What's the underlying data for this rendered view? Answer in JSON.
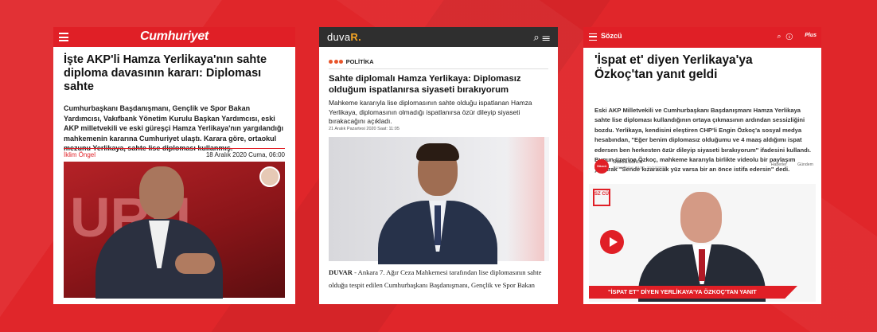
{
  "cumhuriyet": {
    "logo": "Cumhuriyet",
    "title": "İşte AKP'li Hamza Yerlikaya'nın sahte diploma davasının kararı: Diploması sahte",
    "summary": "Cumhurbaşkanı Başdanışmanı, Gençlik ve Spor Bakan Yardımcısı, Vakıfbank Yönetim Kurulu Başkan Yardımcısı, eski AKP milletvekili ve eski güreşçi Hamza Yerlikaya'nın yargılandığı mahkemenin kararına Cumhuriyet ulaştı. Karara göre, ortaokul mezunu Yerlikaya, sahte lise diploması kullanmış.",
    "author": "İklim Öngel",
    "date": "18 Aralık 2020 Cuma, 06:00"
  },
  "duvar": {
    "logo_prefix": "duva",
    "logo_suffix": "R.",
    "kicker": "POLİTİKA",
    "title": "Sahte diplomalı Hamza Yerlikaya: Diplomasız olduğum ispatlanırsa siyaseti bırakıyorum",
    "summary": "Mahkeme kararıyla lise diplomasının sahte olduğu ispatlanan Hamza Yerlikaya, diplomasının olmadığı ispatlanırsa özür dileyip siyaseti bırakacağını açıkladı.",
    "date": "21 Aralık Pazartesi 2020   Saat: 11:05",
    "body_lead": "DUVAR",
    "body": " - Ankara 7. Ağır Ceza Mahkemesi tarafından lise diplomasının sahte olduğu tespit edilen Cumhurbaşkanı Başdanışmanı, Gençlik ve Spor Bakan"
  },
  "sozcu": {
    "logo": "Sözcü",
    "plus": "Plus",
    "title": "'İspat et' diyen Yerlikaya'ya Özkoç'tan yanıt geldi",
    "summary": "Eski AKP Milletvekili ve Cumhurbaşkanı Başdanışmanı Hamza Yerlikaya sahte lise diploması kullandığının ortaya çıkmasının ardından sessizliğini bozdu. Yerlikaya, kendisini eleştiren CHP'li Engin Özkoç'a sosyal medya hesabından, \"Eğer benim diplomasız olduğumu ve 4 maaş aldığımı ispat edersen ben herkesten özür dileyip siyaseti bırakıyorum\" ifadesini kullandı. Bunun üzerine Özkoç, mahkeme kararıyla birlikte videolu bir paylaşım yaparak \"Sende kızaracak yüz varsa bir an önce istifa edersin\" dedi.",
    "avatar_label": "Sözcü",
    "source": "Sozcu.com.tr",
    "source_date": "Güncelleme: 16:51, 21/12/2020",
    "tag1": "Haberler",
    "tag2": "Gündem",
    "video_logo": "SZ CÜ",
    "video_caption": "\"İSPAT ET\" DİYEN YERLİKAYA'YA ÖZKOÇ'TAN YANIT"
  },
  "colors": {
    "background": "#e0262a",
    "cumhuriyet_red": "#e01f26",
    "duvar_bar": "#2f2f2f",
    "duvar_accent": "#f5a524",
    "sozcu_red": "#e01f26"
  },
  "icons": [
    "menu-icon",
    "search-icon",
    "info-icon",
    "play-icon"
  ]
}
